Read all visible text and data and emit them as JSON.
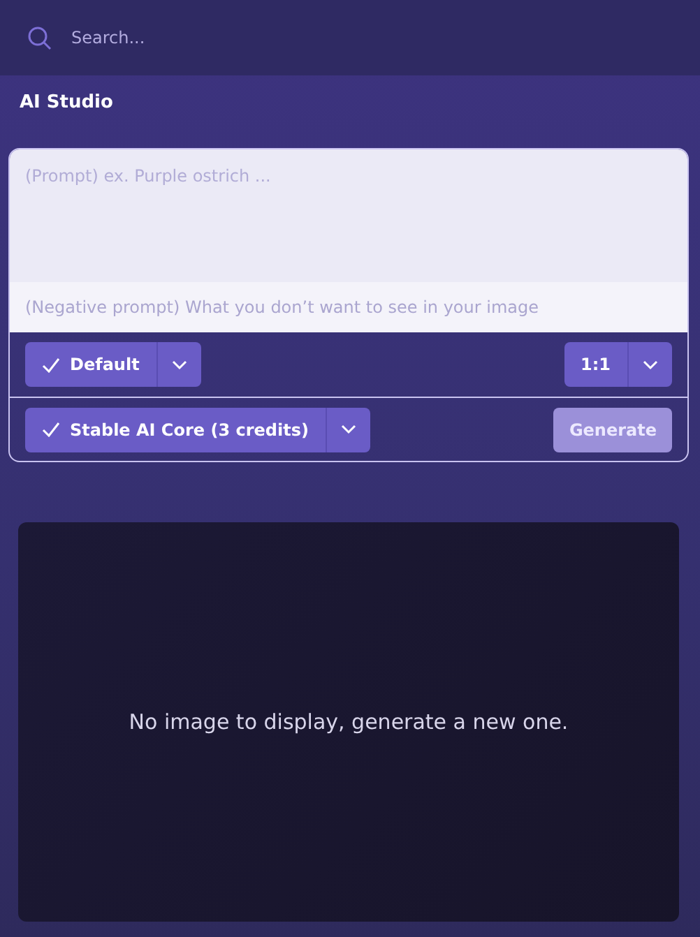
{
  "search": {
    "placeholder": "Search..."
  },
  "title": "AI Studio",
  "prompt": {
    "placeholder": "(Prompt) ex. Purple ostrich ..."
  },
  "negative_prompt": {
    "placeholder": "(Negative prompt) What you don’t want to see in your image"
  },
  "style_select": {
    "label": "Default",
    "checked": true
  },
  "ratio_select": {
    "label": "1:1"
  },
  "model_select": {
    "label": "Stable AI Core (3 credits)",
    "checked": true
  },
  "generate_button": {
    "label": "Generate",
    "disabled": true
  },
  "preview": {
    "message": "No image to display, generate a new one."
  }
}
